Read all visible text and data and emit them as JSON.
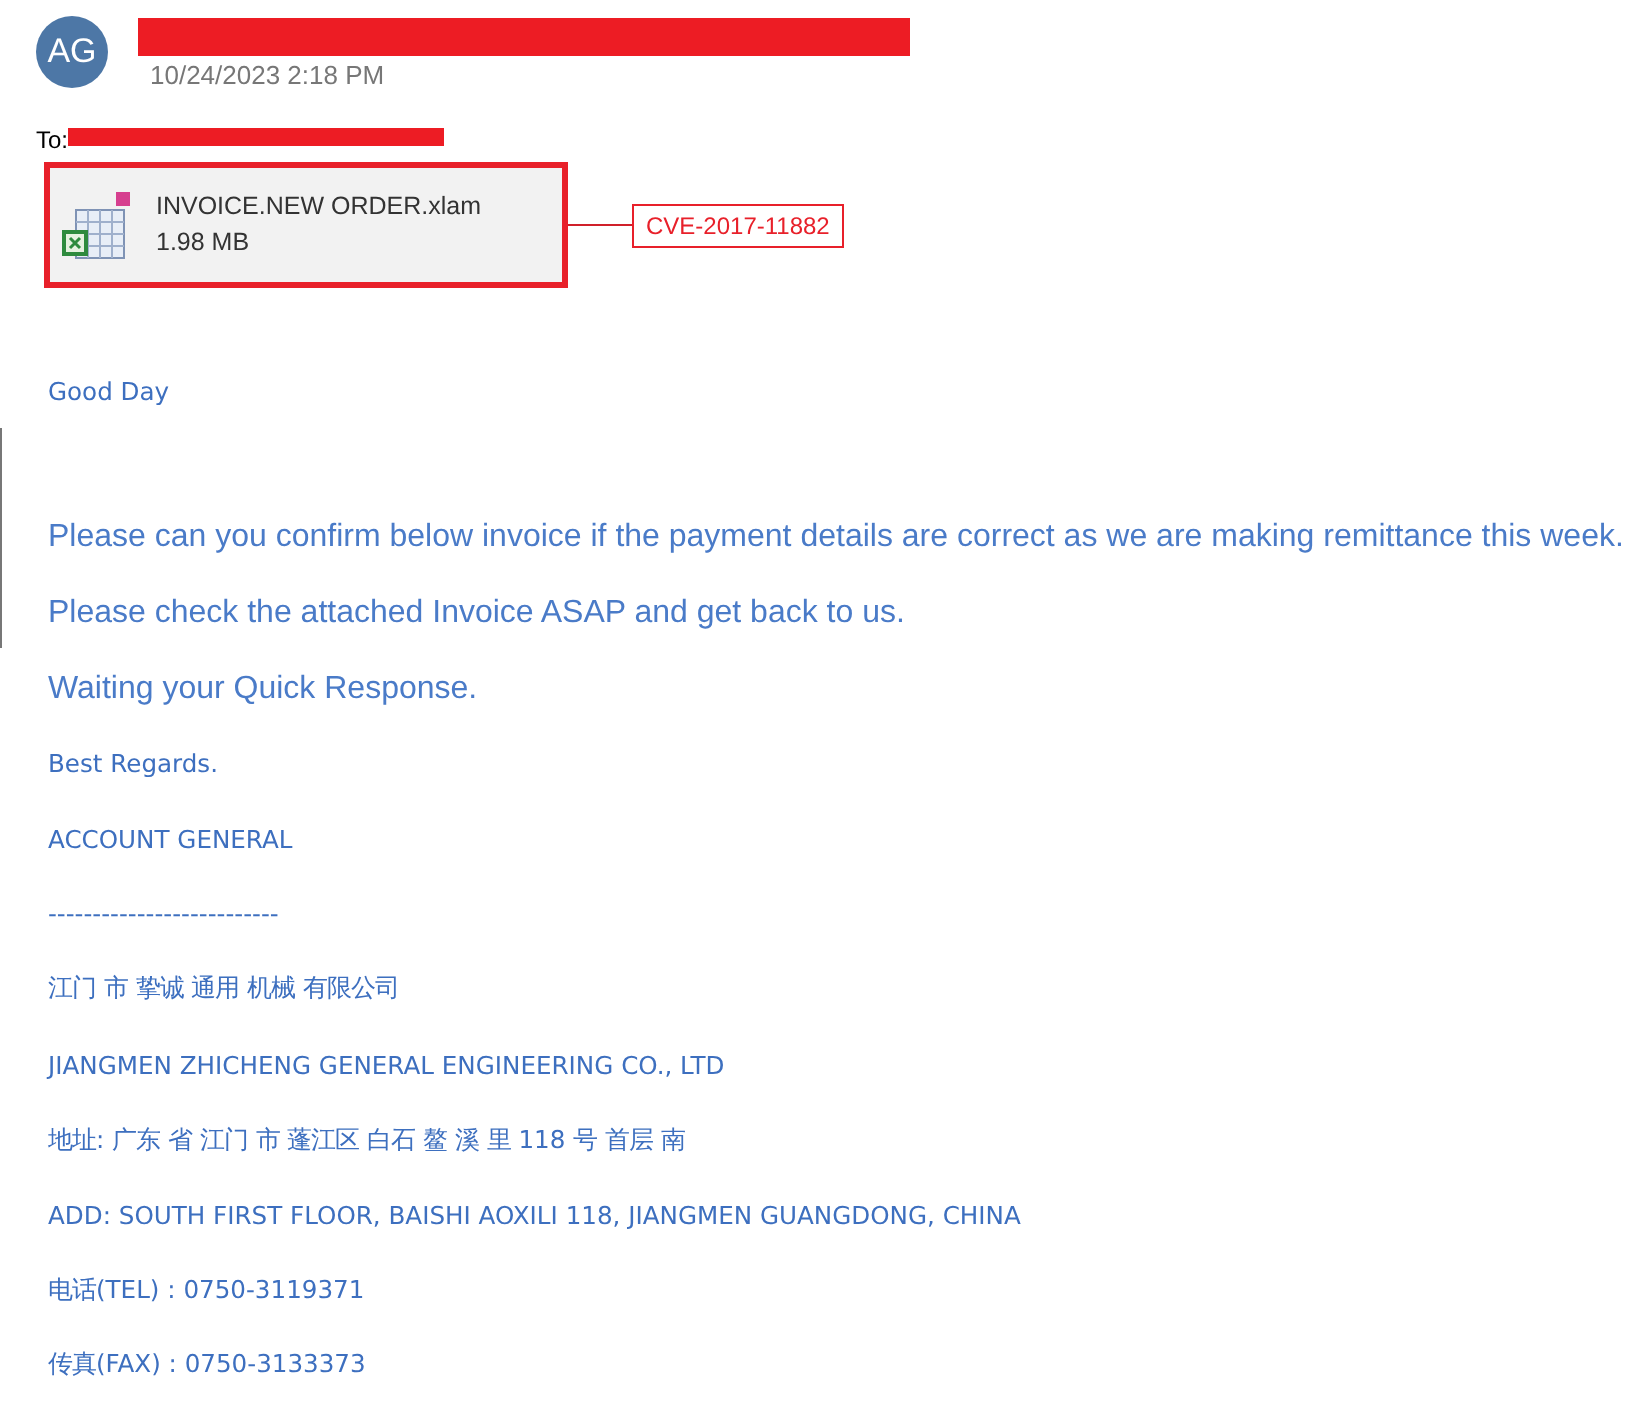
{
  "sender": {
    "initials": "AG",
    "redacted": true
  },
  "date": "10/24/2023 2:18 PM",
  "to": {
    "label": "To:",
    "redacted": true
  },
  "attachment": {
    "name": "INVOICE.NEW ORDER.xlam",
    "size": "1.98 MB",
    "highlighted": true,
    "annotation": "CVE-2017-11882"
  },
  "body": [
    {
      "kind": "small",
      "text": "Good Day"
    },
    {
      "kind": "large",
      "text": "Please can you confirm below invoice if the payment details are correct as we are making remittance this week."
    },
    {
      "kind": "large",
      "text": "Please check the attached Invoice ASAP and get back to us."
    },
    {
      "kind": "large",
      "text": "Waiting your Quick Response."
    },
    {
      "kind": "small",
      "text": "Best Regards."
    },
    {
      "kind": "small",
      "text": "ACCOUNT GENERAL"
    },
    {
      "kind": "small",
      "text": "--------------------------"
    },
    {
      "kind": "small",
      "text": "江门 市 挚诚 通用 机械 有限公司"
    },
    {
      "kind": "small",
      "text": "JIANGMEN ZHICHENG GENERAL ENGINEERING CO., LTD"
    },
    {
      "kind": "small",
      "text": "地址: 广东 省 江门 市 蓬江区 白石 鳌 溪 里 118 号 首层 南"
    },
    {
      "kind": "small",
      "text": "ADD: SOUTH FIRST FLOOR, BAISHI AOXILI 118, JIANGMEN GUANGDONG, CHINA"
    },
    {
      "kind": "small",
      "text": "电话(TEL) : 0750-3119371"
    },
    {
      "kind": "small",
      "text": "传真(FAX) : 0750-3133373"
    }
  ]
}
